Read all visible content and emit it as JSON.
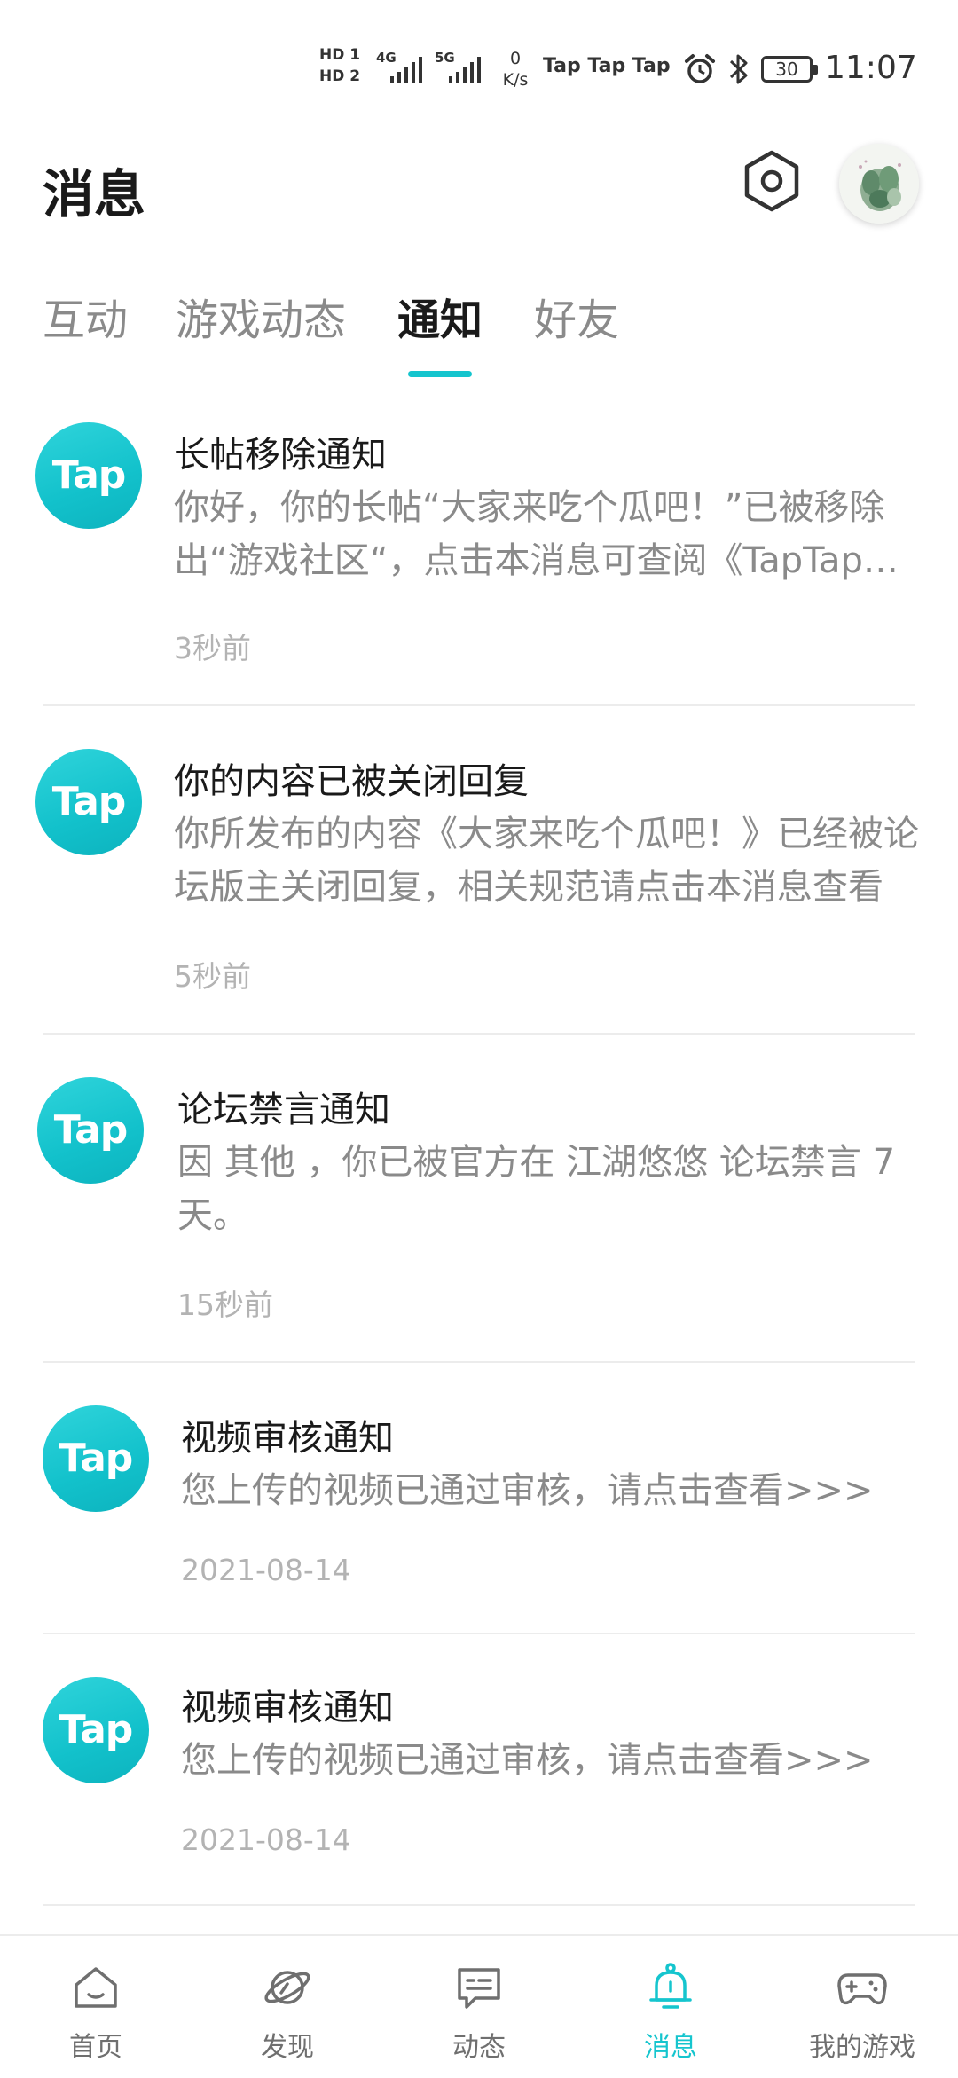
{
  "status_bar": {
    "hd1": "HD 1",
    "hd2": "HD 2",
    "net1": "4G",
    "net2": "5G",
    "speed_value": "0",
    "speed_unit": "K/s",
    "tap_icons": "Tap Tap Tap",
    "battery": "30",
    "time": "11:07"
  },
  "header": {
    "title": "消息"
  },
  "tabs": [
    {
      "label": "互动"
    },
    {
      "label": "游戏动态"
    },
    {
      "label": "通知"
    },
    {
      "label": "好友"
    }
  ],
  "active_tab": "通知",
  "notifications": [
    {
      "logo": "Tap",
      "title": "长帖移除通知",
      "body": "你好，你的长帖“大家来吃个瓜吧！”已被移除出“游戏社区“，点击本消息可查阅《TapTap社区规范》",
      "time": "3秒前"
    },
    {
      "logo": "Tap",
      "title": "你的内容已被关闭回复",
      "body": "你所发布的内容《大家来吃个瓜吧！》已经被论坛版主关闭回复，相关规范请点击本消息查看",
      "time": "5秒前"
    },
    {
      "logo": "Tap",
      "title": "论坛禁言通知",
      "body": "因 其他 ，你已被官方在 江湖悠悠 论坛禁言 7 天。",
      "time": "15秒前"
    },
    {
      "logo": "Tap",
      "title": "视频审核通知",
      "body": "您上传的视频已通过审核，请点击查看>>>",
      "time": "2021-08-14"
    },
    {
      "logo": "Tap",
      "title": "视频审核通知",
      "body": "您上传的视频已通过审核，请点击查看>>>",
      "time": "2021-08-14"
    }
  ],
  "bottom_nav": [
    {
      "label": "首页",
      "icon": "home-icon"
    },
    {
      "label": "发现",
      "icon": "planet-icon"
    },
    {
      "label": "动态",
      "icon": "chat-icon"
    },
    {
      "label": "消息",
      "icon": "bell-icon"
    },
    {
      "label": "我的游戏",
      "icon": "gamepad-icon"
    }
  ],
  "colors": {
    "accent": "#15c5ce",
    "muted": "#8a8a8a",
    "time": "#b3b3b3"
  }
}
